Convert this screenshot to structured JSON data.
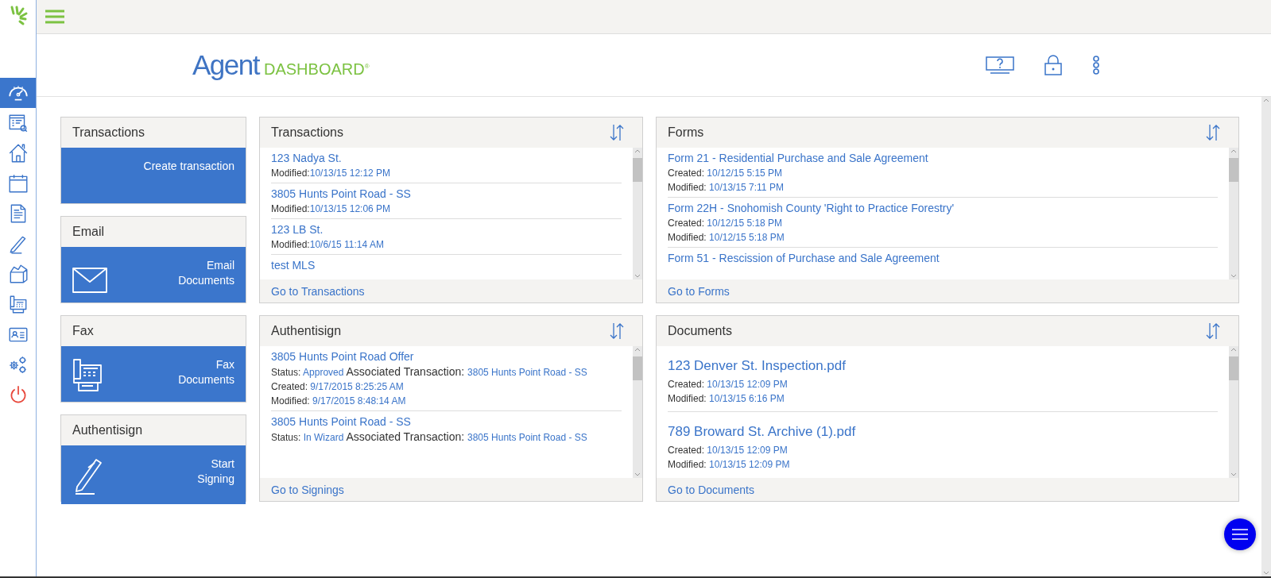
{
  "brand": {
    "word": "Agent",
    "product": "DASHBOARD$^{®}$"
  },
  "nav": [
    {
      "selected": true
    },
    {
      "selected": false
    },
    {
      "selected": false
    },
    {
      "selected": false
    },
    {
      "selected": false
    },
    {
      "selected": false
    },
    {
      "selected": false
    },
    {
      "selected": false
    },
    {
      "selected": false
    },
    {
      "selected": false
    },
    {
      "selected": false
    }
  ],
  "action_cards": [
    {
      "title": "Transactions",
      "action": "Create transaction"
    },
    {
      "title": "Email",
      "action": "Email\nDocuments"
    },
    {
      "title": "Fax",
      "action": "Fax\nDocuments"
    },
    {
      "title": "Authentisign",
      "action": "Start\nSigning"
    }
  ],
  "panels": [
    {
      "title": "Transactions",
      "kind": "compact",
      "footer_link": "Go to Transactions",
      "items": [
        {
          "title": "123 Nadya St.",
          "lines": [
            [
              {
                "kind": "label",
                "text": "Modified:"
              },
              {
                "kind": "value",
                "text": "10/13/15 12:12 PM"
              }
            ]
          ]
        },
        {
          "title": "3805 Hunts Point Road - SS",
          "lines": [
            [
              {
                "kind": "label",
                "text": "Modified:"
              },
              {
                "kind": "value",
                "text": "10/13/15 12:06 PM"
              }
            ]
          ]
        },
        {
          "title": "123 LB St.",
          "lines": [
            [
              {
                "kind": "label",
                "text": "Modified:"
              },
              {
                "kind": "value",
                "text": "10/6/15 11:14 AM"
              }
            ]
          ]
        },
        {
          "title": "test MLS"
        }
      ]
    },
    {
      "title": "Forms",
      "kind": "compact",
      "footer_link": "Go to Forms",
      "items": [
        {
          "title": "Form 21 - Residential Purchase and Sale Agreement",
          "lines": [
            [
              {
                "kind": "label",
                "text": "Created: "
              },
              {
                "kind": "value",
                "text": "10/12/15 5:15 PM"
              }
            ],
            [
              {
                "kind": "label",
                "text": "Modified: "
              },
              {
                "kind": "value",
                "text": "10/13/15 7:11 PM"
              }
            ]
          ]
        },
        {
          "title": "Form 22H - Snohomish County 'Right to Practice Forestry'",
          "lines": [
            [
              {
                "kind": "label",
                "text": "Created: "
              },
              {
                "kind": "value",
                "text": "10/12/15 5:18 PM"
              }
            ],
            [
              {
                "kind": "label",
                "text": "Modified: "
              },
              {
                "kind": "value",
                "text": "10/12/15 5:18 PM"
              }
            ]
          ]
        },
        {
          "title": "Form 51 - Rescission of Purchase and Sale Agreement"
        }
      ]
    },
    {
      "title": "Authentisign",
      "kind": "compact",
      "footer_link": "Go to Signings",
      "items": [
        {
          "title": "3805 Hunts Point Road Offer",
          "lines": [
            [
              {
                "kind": "label",
                "text": "Status: "
              },
              {
                "kind": "value",
                "text": "Approved"
              },
              {
                "kind": "strong",
                "text": " Associated Transaction: "
              },
              {
                "kind": "value",
                "text": "3805 Hunts Point Road - SS"
              }
            ],
            [
              {
                "kind": "label",
                "text": "Created: "
              },
              {
                "kind": "value",
                "text": "9/17/2015 8:25:25 AM"
              }
            ],
            [
              {
                "kind": "label",
                "text": "Modified: "
              },
              {
                "kind": "value",
                "text": "9/17/2015 8:48:14 AM"
              }
            ]
          ]
        },
        {
          "title": "3805 Hunts Point Road - SS",
          "lines": [
            [
              {
                "kind": "label",
                "text": "Status: "
              },
              {
                "kind": "value",
                "text": "In Wizard"
              },
              {
                "kind": "strong",
                "text": " Associated Transaction: "
              },
              {
                "kind": "value",
                "text": "3805 Hunts Point Road - SS"
              }
            ]
          ]
        }
      ]
    },
    {
      "title": "Documents",
      "kind": "large",
      "footer_link": "Go to Documents",
      "items": [
        {
          "title": "123 Denver St. Inspection.pdf",
          "lines": [
            [
              {
                "kind": "label",
                "text": "Created: "
              },
              {
                "kind": "value",
                "text": "10/13/15 12:09 PM"
              }
            ],
            [
              {
                "kind": "label",
                "text": "Modified: "
              },
              {
                "kind": "value",
                "text": "10/13/15 6:16 PM"
              }
            ]
          ]
        },
        {
          "title": "789 Broward St. Archive (1).pdf",
          "lines": [
            [
              {
                "kind": "label",
                "text": "Created: "
              },
              {
                "kind": "value",
                "text": "10/13/15 12:09 PM"
              }
            ],
            [
              {
                "kind": "label",
                "text": "Modified: "
              },
              {
                "kind": "value",
                "text": "10/13/15 12:09 PM"
              }
            ]
          ]
        }
      ]
    }
  ]
}
